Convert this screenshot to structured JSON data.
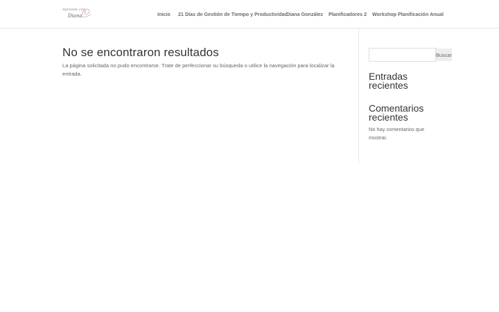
{
  "logo": {
    "script_text": "Aprende con",
    "name_text": "Diana"
  },
  "nav": {
    "items": [
      {
        "label": "Inicio"
      },
      {
        "label": "21 Días de Gestión de Tiempo y Productividad"
      },
      {
        "label": "Diana González"
      },
      {
        "label": "Planificadores 2"
      },
      {
        "label": "Workshop Planificación Anual"
      }
    ]
  },
  "main": {
    "title": "No se encontraron resultados",
    "text": "La página solicitada no pudo encontrarse. Trate de perfeccionar su búsqueda o utilice la navegación para localizar la entrada."
  },
  "sidebar": {
    "search": {
      "value": "",
      "button_label": "Buscar"
    },
    "recent_posts_title": "Entradas recientes",
    "recent_comments_title": "Comentarios recientes",
    "recent_comments_text": "No hay comentarios que mostrar."
  },
  "colors": {
    "heading": "#333333",
    "body_text": "#666666",
    "nav_text": "#6b6b6b",
    "logo_accent": "#d9a5bb"
  }
}
